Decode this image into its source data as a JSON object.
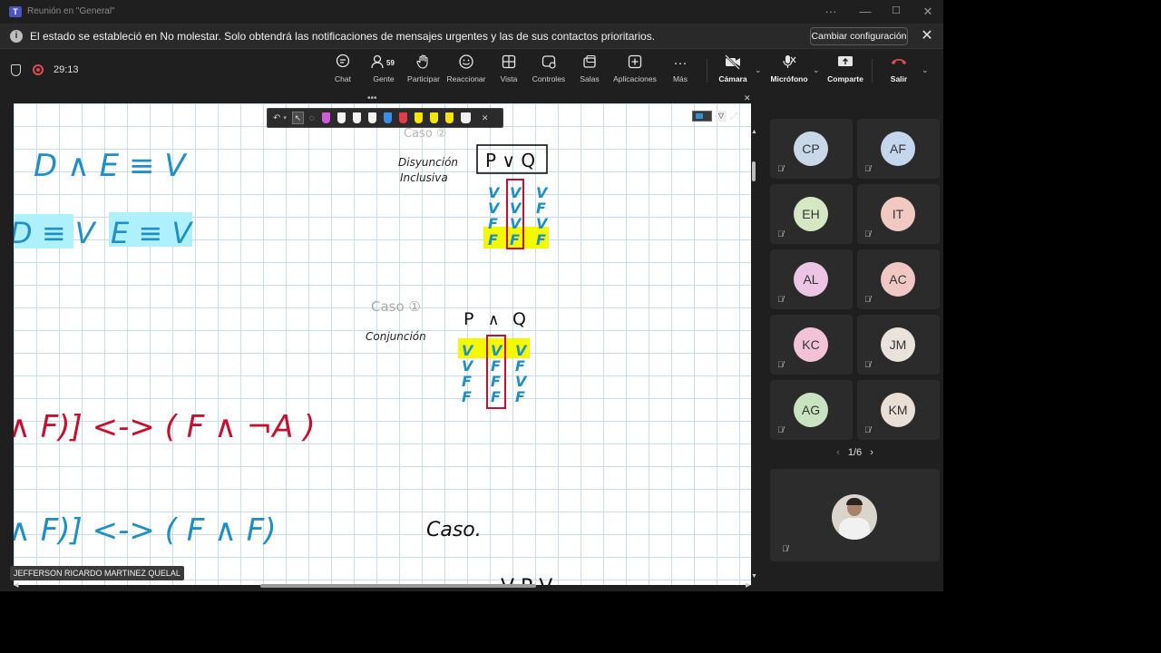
{
  "window": {
    "title": "Reunión en \"General\"",
    "more": "···",
    "minimize": "—",
    "maximize": "☐",
    "close": "✕"
  },
  "notice": {
    "text": "El estado se estableció en No molestar. Solo obtendrá las notificaciones de mensajes urgentes y las de sus contactos prioritarios.",
    "button": "Cambiar configuración",
    "info_icon": "i",
    "close": "✕"
  },
  "meeting": {
    "timer": "29:13",
    "people_count": "59"
  },
  "toolbar": {
    "chat": "Chat",
    "people": "Gente",
    "raise": "Participar",
    "react": "Reaccionar",
    "view": "Vista",
    "controls": "Controles",
    "rooms": "Salas",
    "apps": "Aplicaciones",
    "more": "Más",
    "camera": "Cámara",
    "mic": "Micrófono",
    "share": "Comparte",
    "leave": "Salir"
  },
  "colors": {
    "leave": "#e04b54",
    "accent": "#4b53bc",
    "highlight_yellow": "#f4f800",
    "highlight_cyan": "#aef0fb",
    "ink_blue": "#1f8fc7",
    "ink_red": "#c8102e"
  },
  "whiteboard": {
    "presenter_name": "JEFFERSON RICARDO MARTINEZ QUELAL",
    "case2_label": "Caso ②",
    "disyuncion": "Disyunción",
    "inclusiva": "Inclusiva",
    "pvq": "P ∨ Q",
    "col_p2": [
      "V",
      "V",
      "F",
      "F"
    ],
    "col_res2": [
      "V",
      "V",
      "V",
      "F"
    ],
    "col_q2": [
      "V",
      "F",
      "V",
      "F"
    ],
    "case1_label": "Caso ①",
    "conjuncion": "Conjunción",
    "pq_p": "P",
    "pq_op": "∧",
    "pq_q": "Q",
    "col_p1": [
      "V",
      "V",
      "F",
      "F"
    ],
    "col_res1": [
      "V",
      "F",
      "F",
      "F"
    ],
    "col_q1": [
      "V",
      "F",
      "V",
      "F"
    ],
    "eq_top": "D ∧ E ≡ V",
    "eq_d": "D ≡ V",
    "eq_e": "E ≡ V",
    "red_expr": "∧ F)] <-> ( F ∧ ¬A )",
    "blue_expr": "∧ F)] <-> ( F ∧ F)",
    "caso": "Caso.",
    "bottom_hint": "V   P   V"
  },
  "participants": [
    {
      "initials": "CP",
      "color": "#c9d8e8"
    },
    {
      "initials": "AF",
      "color": "#c3d6ee"
    },
    {
      "initials": "EH",
      "color": "#d5e8c3"
    },
    {
      "initials": "IT",
      "color": "#f1c9c2"
    },
    {
      "initials": "AL",
      "color": "#ecc5e4"
    },
    {
      "initials": "AC",
      "color": "#f0c7c2"
    },
    {
      "initials": "KC",
      "color": "#f2c3d6"
    },
    {
      "initials": "JM",
      "color": "#e9e3dc"
    },
    {
      "initials": "AG",
      "color": "#c9e2c0"
    },
    {
      "initials": "KM",
      "color": "#eadfd6"
    }
  ],
  "pager": {
    "text": "1/6",
    "prev": "‹",
    "next": "›"
  }
}
